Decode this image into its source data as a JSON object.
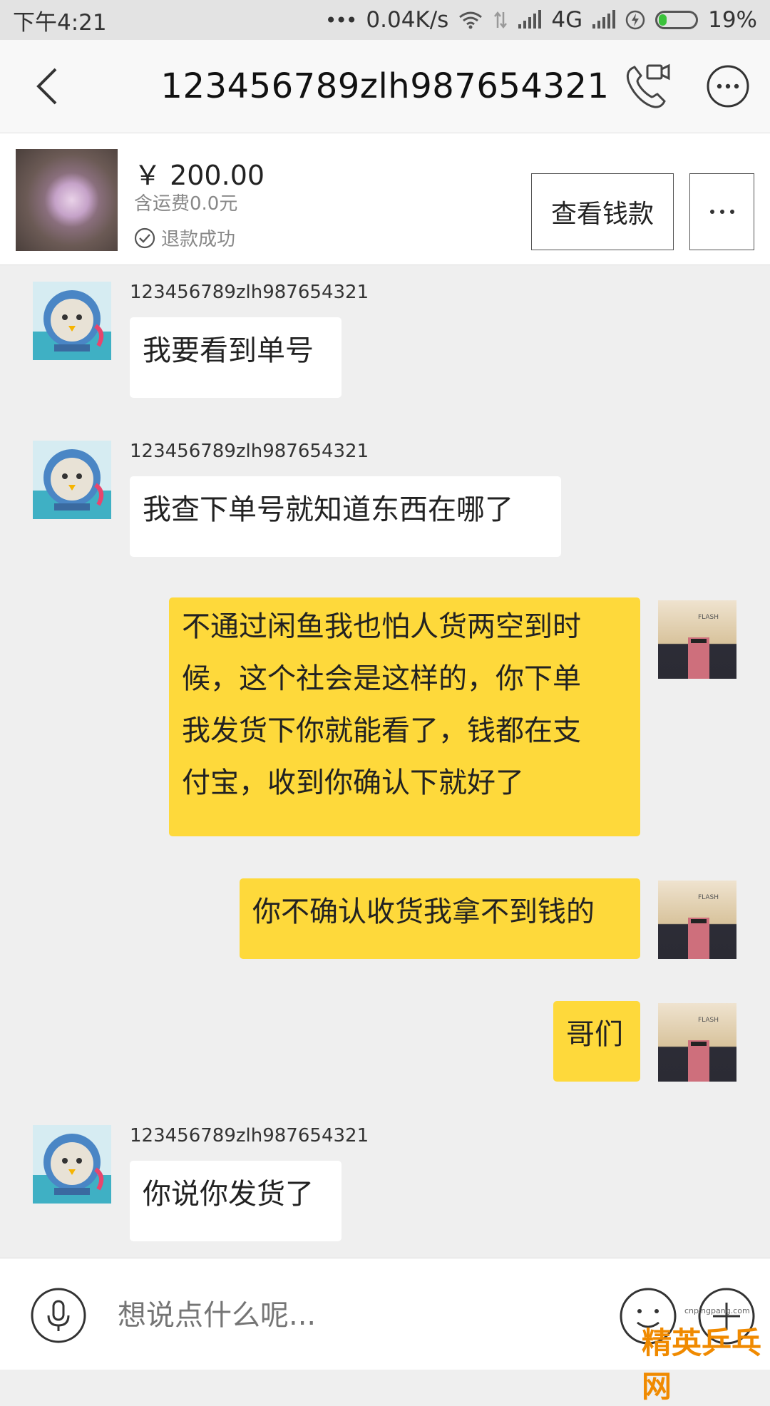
{
  "status_bar": {
    "time": "下午4:21",
    "speed": "0.04K/s",
    "network": "4G",
    "battery": "19%",
    "battery_level": 0.19
  },
  "header": {
    "title": "123456789zlh987654321",
    "back_icon": "chevron-left-icon",
    "call_icon": "video-call-icon",
    "more_icon": "more-icon"
  },
  "product": {
    "price": "￥ 200.00",
    "shipping": "含运费0.0元",
    "status": "退款成功",
    "view_button": "查看钱款"
  },
  "messages": [
    {
      "side": "left",
      "sender": "123456789zlh987654321",
      "text": "我要看到单号"
    },
    {
      "side": "left",
      "sender": "123456789zlh987654321",
      "text": "我查下单号就知道东西在哪了"
    },
    {
      "side": "right",
      "lines": [
        "不通过闲鱼我也怕人货两空到时",
        "候，这个社会是这样的，你下单",
        "我发货下你就能看了，钱都在支",
        "付宝，收到你确认下就好了"
      ]
    },
    {
      "side": "right",
      "text": "你不确认收货我拿不到钱的"
    },
    {
      "side": "right",
      "text": "哥们"
    },
    {
      "side": "left",
      "sender": "123456789zlh987654321",
      "text": "你说你发货了"
    }
  ],
  "input": {
    "placeholder": "想说点什么呢..."
  },
  "watermark": {
    "url": "cnpingpang.com",
    "brand": "精英乒乓网"
  },
  "colors": {
    "own_bubble": "#fed93b",
    "other_bubble": "#ffffff",
    "background": "#efefef"
  }
}
